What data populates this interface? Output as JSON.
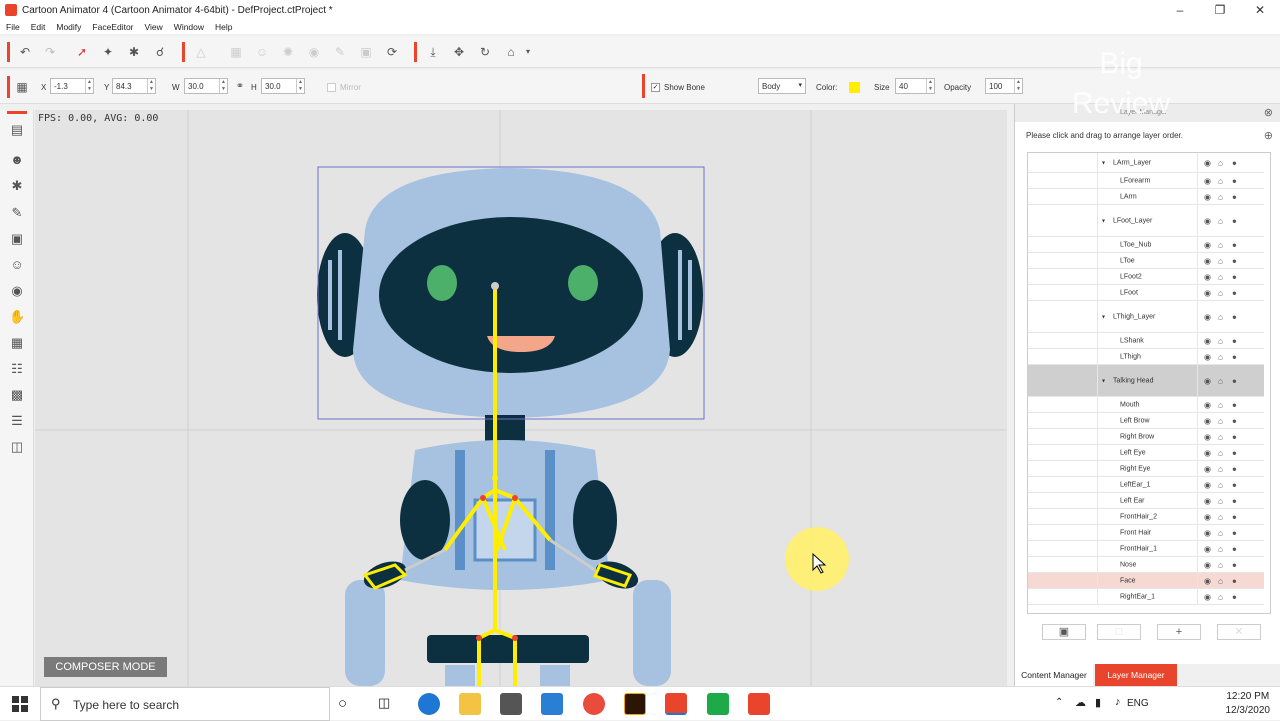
{
  "window": {
    "title": "Cartoon Animator 4  (Cartoon Animator 4-64bit) - DefProject.ctProject *",
    "controls": [
      "minimize",
      "maximize",
      "close"
    ]
  },
  "menu": [
    "File",
    "Edit",
    "Modify",
    "FaceEditor",
    "View",
    "Window",
    "Help"
  ],
  "transform": {
    "x_label": "X",
    "x_value": "-1.3",
    "y_label": "Y",
    "y_value": "84.3",
    "w_label": "W",
    "w_value": "30.0",
    "h_label": "H",
    "h_value": "30.0",
    "mirror_label": "Mirror"
  },
  "bone_settings": {
    "show_bone_label": "Show Bone",
    "mode_value": "Body",
    "color_label": "Color:",
    "color_value": "#ffee00",
    "size_label": "Size",
    "size_value": "40",
    "opacity_label": "Opacity",
    "opacity_value": "100"
  },
  "viewport": {
    "fps_text": "FPS: 0.00, AVG: 0.00",
    "mode_badge": "COMPOSER MODE"
  },
  "layer_panel": {
    "title": "Layer Manager",
    "hint": "Please click and drag to arrange layer order.",
    "layers": [
      {
        "name": "LArm_Layer",
        "group": true,
        "selected": false
      },
      {
        "name": "LForearm",
        "group": false,
        "selected": false
      },
      {
        "name": "LArm",
        "group": false,
        "selected": false
      },
      {
        "name": "LFoot_Layer",
        "group": true,
        "selected": false
      },
      {
        "name": "LToe_Nub",
        "group": false,
        "selected": false
      },
      {
        "name": "LToe",
        "group": false,
        "selected": false
      },
      {
        "name": "LFoot2",
        "group": false,
        "selected": false
      },
      {
        "name": "LFoot",
        "group": false,
        "selected": false
      },
      {
        "name": "LThigh_Layer",
        "group": true,
        "selected": false
      },
      {
        "name": "LShank",
        "group": false,
        "selected": false
      },
      {
        "name": "LThigh",
        "group": false,
        "selected": false
      },
      {
        "name": "Talking Head",
        "group": true,
        "selected": true
      },
      {
        "name": "Mouth",
        "group": false,
        "selected": false
      },
      {
        "name": "Left Brow",
        "group": false,
        "selected": false
      },
      {
        "name": "Right Brow",
        "group": false,
        "selected": false
      },
      {
        "name": "Left Eye",
        "group": false,
        "selected": false
      },
      {
        "name": "Right Eye",
        "group": false,
        "selected": false
      },
      {
        "name": "LeftEar_1",
        "group": false,
        "selected": false
      },
      {
        "name": "Left Ear",
        "group": false,
        "selected": false
      },
      {
        "name": "FrontHair_2",
        "group": false,
        "selected": false
      },
      {
        "name": "Front Hair",
        "group": false,
        "selected": false
      },
      {
        "name": "FrontHair_1",
        "group": false,
        "selected": false
      },
      {
        "name": "Nose",
        "group": false,
        "selected": false
      },
      {
        "name": "Face",
        "group": false,
        "selected": false,
        "highlight": true
      },
      {
        "name": "RightEar_1",
        "group": false,
        "selected": false
      }
    ],
    "tabs": [
      "Content Manager",
      "Layer Manager"
    ],
    "active_tab": "Layer Manager"
  },
  "taskbar": {
    "search_placeholder": "Type here to search",
    "language": "ENG",
    "time": "12:20 PM",
    "date": "12/3/2020"
  },
  "watermark": {
    "line1": "Big",
    "line2": "Review"
  },
  "colors": {
    "accent": "#e8452c",
    "bone": "#ffee00",
    "robot_body": "#a7c1e0",
    "robot_dark": "#0d3040",
    "robot_eye": "#4caf6a"
  }
}
